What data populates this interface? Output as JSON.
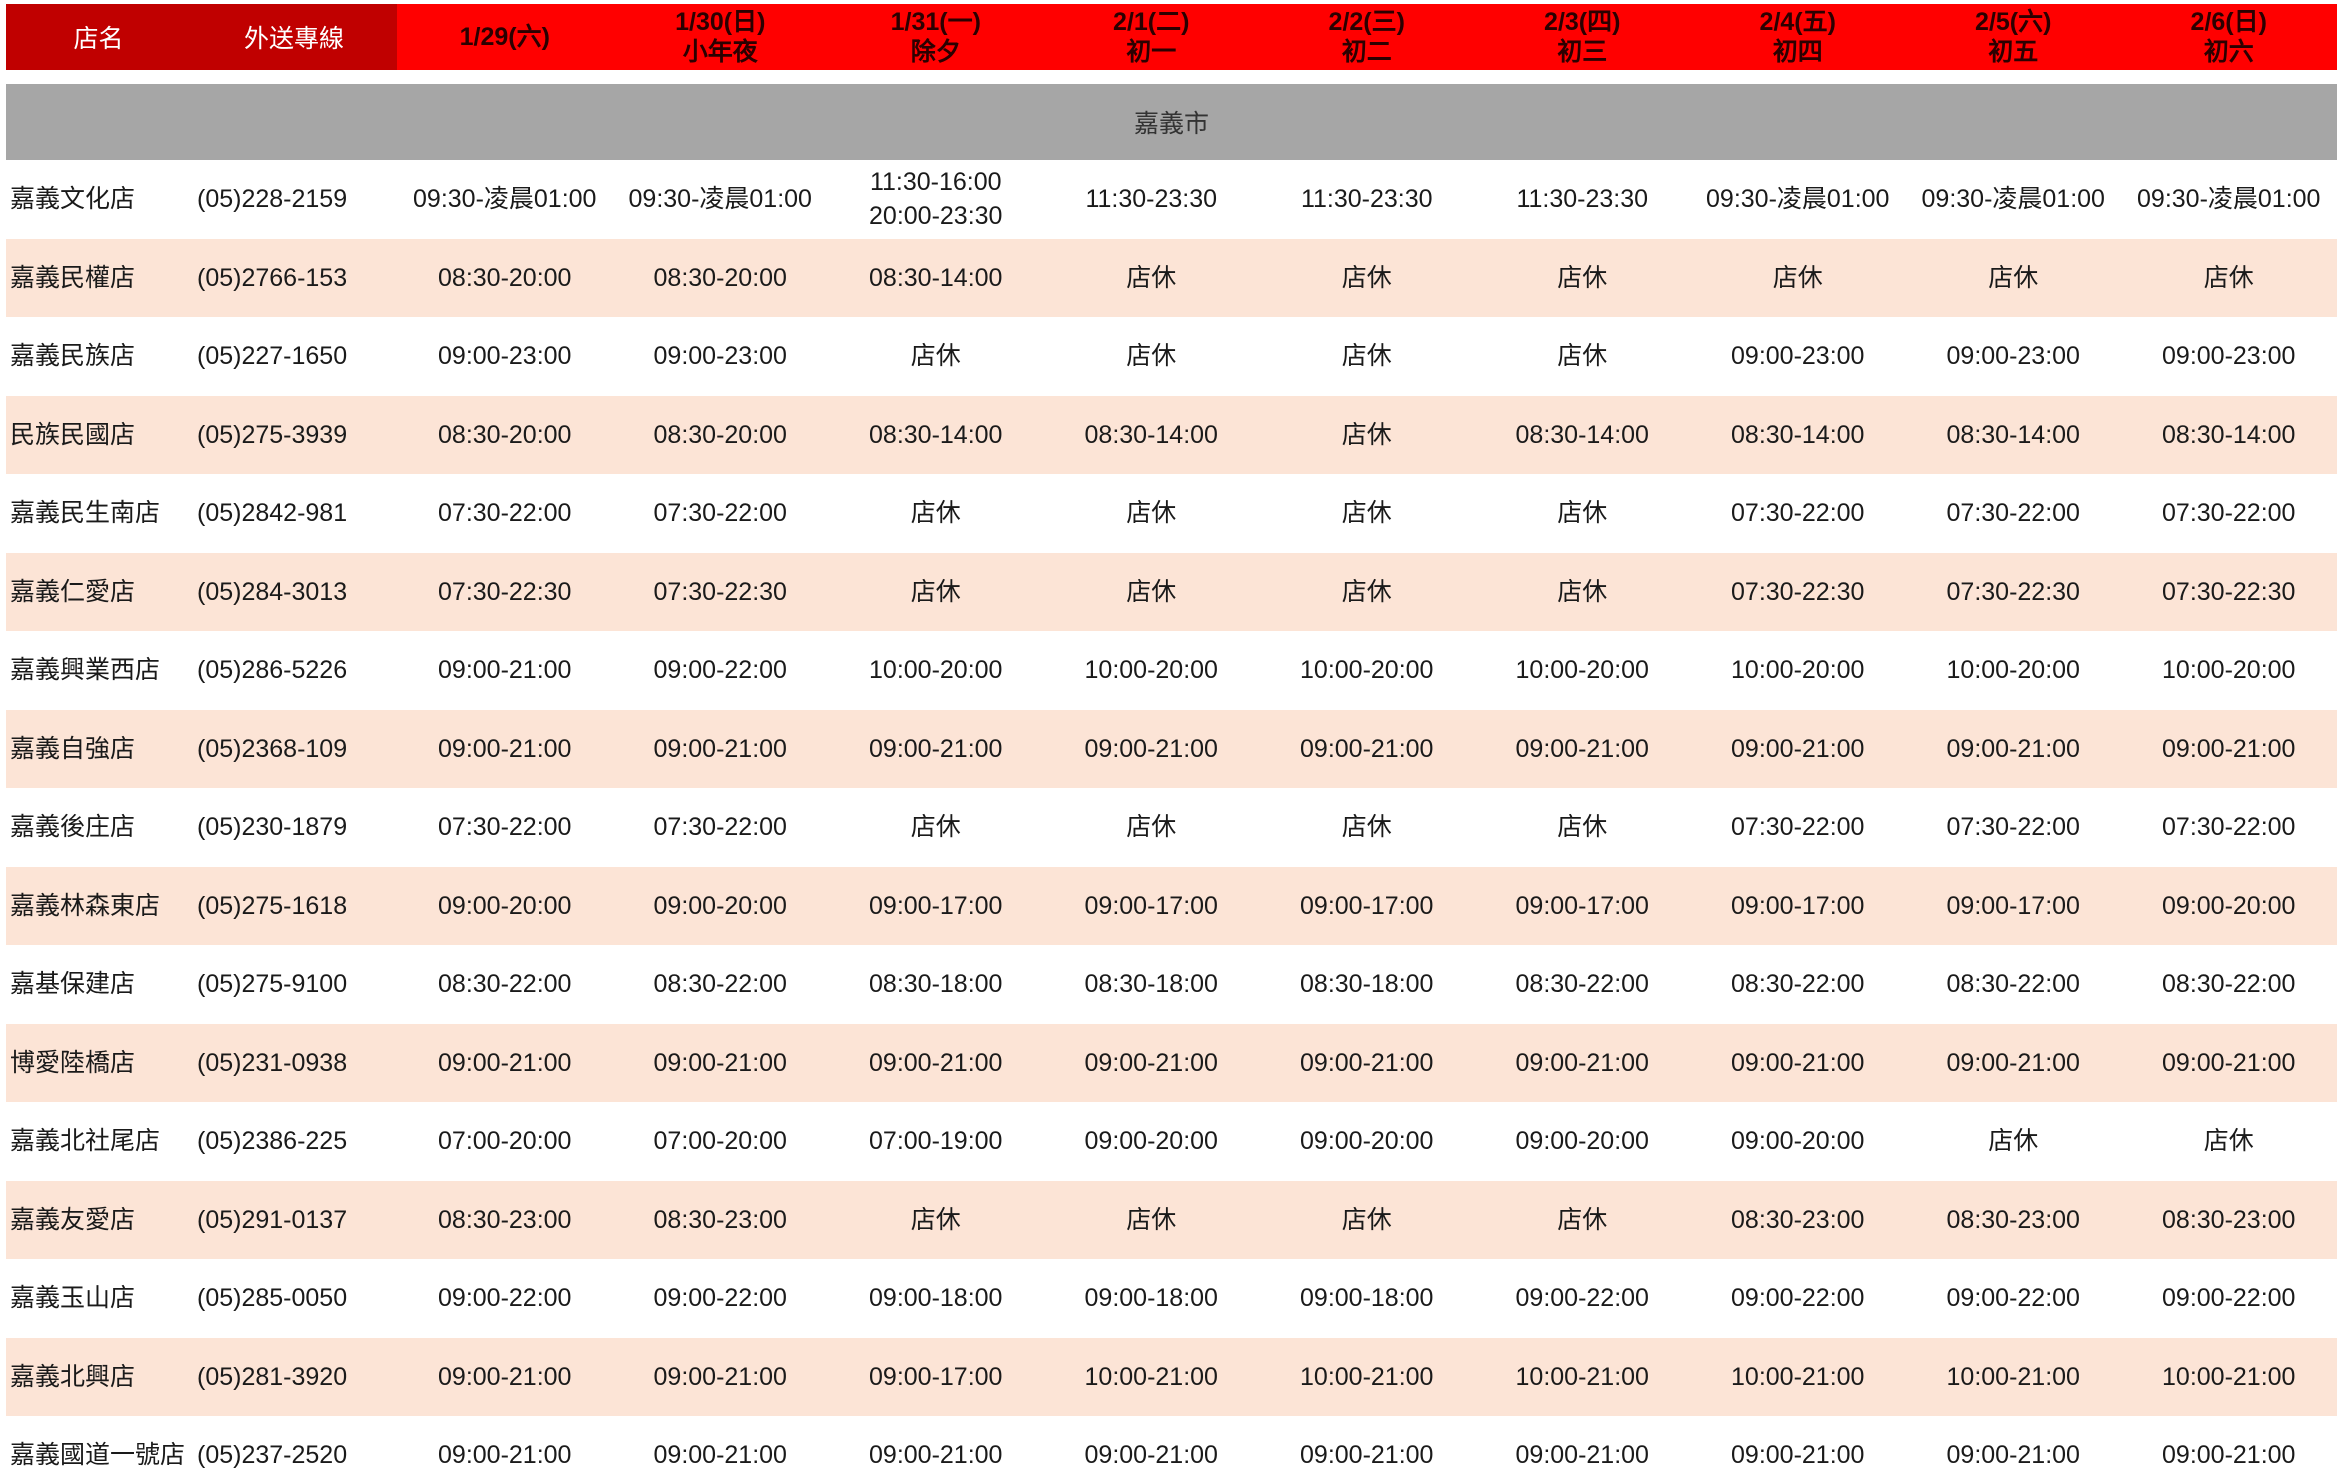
{
  "colors": {
    "header_dark_red": "#c00000",
    "header_red": "#ff0000",
    "section_gray": "#a6a6a6",
    "row_stripe": "#fce4d6"
  },
  "header": {
    "store_label": "店名",
    "phone_label": "外送專線",
    "days": [
      {
        "date": "1/29(六)"
      },
      {
        "date": "1/30(日)",
        "note": "小年夜"
      },
      {
        "date": "1/31(一)",
        "note": "除夕"
      },
      {
        "date": "2/1(二)",
        "note": "初一"
      },
      {
        "date": "2/2(三)",
        "note": "初二"
      },
      {
        "date": "2/3(四)",
        "note": "初三"
      },
      {
        "date": "2/4(五)",
        "note": "初四"
      },
      {
        "date": "2/5(六)",
        "note": "初五"
      },
      {
        "date": "2/6(日)",
        "note": "初六"
      }
    ]
  },
  "section": {
    "city": "嘉義市"
  },
  "stores": [
    {
      "name": "嘉義文化店",
      "phone": "(05)228-2159",
      "hours": [
        "09:30-凌晨01:00",
        "09:30-凌晨01:00",
        "11:30-16:00\n20:00-23:30",
        "11:30-23:30",
        "11:30-23:30",
        "11:30-23:30",
        "09:30-凌晨01:00",
        "09:30-凌晨01:00",
        "09:30-凌晨01:00"
      ]
    },
    {
      "name": "嘉義民權店",
      "phone": "(05)2766-153",
      "hours": [
        "08:30-20:00",
        "08:30-20:00",
        "08:30-14:00",
        "店休",
        "店休",
        "店休",
        "店休",
        "店休",
        "店休"
      ]
    },
    {
      "name": "嘉義民族店",
      "phone": "(05)227-1650",
      "hours": [
        "09:00-23:00",
        "09:00-23:00",
        "店休",
        "店休",
        "店休",
        "店休",
        "09:00-23:00",
        "09:00-23:00",
        "09:00-23:00"
      ]
    },
    {
      "name": "民族民國店",
      "phone": "(05)275-3939",
      "hours": [
        "08:30-20:00",
        "08:30-20:00",
        "08:30-14:00",
        "08:30-14:00",
        "店休",
        "08:30-14:00",
        "08:30-14:00",
        "08:30-14:00",
        "08:30-14:00"
      ]
    },
    {
      "name": "嘉義民生南店",
      "phone": "(05)2842-981",
      "hours": [
        "07:30-22:00",
        "07:30-22:00",
        "店休",
        "店休",
        "店休",
        "店休",
        "07:30-22:00",
        "07:30-22:00",
        "07:30-22:00"
      ]
    },
    {
      "name": "嘉義仁愛店",
      "phone": "(05)284-3013",
      "hours": [
        "07:30-22:30",
        "07:30-22:30",
        "店休",
        "店休",
        "店休",
        "店休",
        "07:30-22:30",
        "07:30-22:30",
        "07:30-22:30"
      ]
    },
    {
      "name": "嘉義興業西店",
      "phone": "(05)286-5226",
      "hours": [
        "09:00-21:00",
        "09:00-22:00",
        "10:00-20:00",
        "10:00-20:00",
        "10:00-20:00",
        "10:00-20:00",
        "10:00-20:00",
        "10:00-20:00",
        "10:00-20:00"
      ]
    },
    {
      "name": "嘉義自強店",
      "phone": "(05)2368-109",
      "hours": [
        "09:00-21:00",
        "09:00-21:00",
        "09:00-21:00",
        "09:00-21:00",
        "09:00-21:00",
        "09:00-21:00",
        "09:00-21:00",
        "09:00-21:00",
        "09:00-21:00"
      ]
    },
    {
      "name": "嘉義後庄店",
      "phone": "(05)230-1879",
      "hours": [
        "07:30-22:00",
        "07:30-22:00",
        "店休",
        "店休",
        "店休",
        "店休",
        "07:30-22:00",
        "07:30-22:00",
        "07:30-22:00"
      ]
    },
    {
      "name": "嘉義林森東店",
      "phone": "(05)275-1618",
      "hours": [
        "09:00-20:00",
        "09:00-20:00",
        "09:00-17:00",
        "09:00-17:00",
        "09:00-17:00",
        "09:00-17:00",
        "09:00-17:00",
        "09:00-17:00",
        "09:00-20:00"
      ]
    },
    {
      "name": "嘉基保建店",
      "phone": "(05)275-9100",
      "hours": [
        "08:30-22:00",
        "08:30-22:00",
        "08:30-18:00",
        "08:30-18:00",
        "08:30-18:00",
        "08:30-22:00",
        "08:30-22:00",
        "08:30-22:00",
        "08:30-22:00"
      ]
    },
    {
      "name": "博愛陸橋店",
      "phone": "(05)231-0938",
      "hours": [
        "09:00-21:00",
        "09:00-21:00",
        "09:00-21:00",
        "09:00-21:00",
        "09:00-21:00",
        "09:00-21:00",
        "09:00-21:00",
        "09:00-21:00",
        "09:00-21:00"
      ]
    },
    {
      "name": "嘉義北社尾店",
      "phone": "(05)2386-225",
      "hours": [
        "07:00-20:00",
        "07:00-20:00",
        "07:00-19:00",
        "09:00-20:00",
        "09:00-20:00",
        "09:00-20:00",
        "09:00-20:00",
        "店休",
        "店休"
      ]
    },
    {
      "name": "嘉義友愛店",
      "phone": "(05)291-0137",
      "hours": [
        "08:30-23:00",
        "08:30-23:00",
        "店休",
        "店休",
        "店休",
        "店休",
        "08:30-23:00",
        "08:30-23:00",
        "08:30-23:00"
      ]
    },
    {
      "name": "嘉義玉山店",
      "phone": "(05)285-0050",
      "hours": [
        "09:00-22:00",
        "09:00-22:00",
        "09:00-18:00",
        "09:00-18:00",
        "09:00-18:00",
        "09:00-22:00",
        "09:00-22:00",
        "09:00-22:00",
        "09:00-22:00"
      ]
    },
    {
      "name": "嘉義北興店",
      "phone": "(05)281-3920",
      "hours": [
        "09:00-21:00",
        "09:00-21:00",
        "09:00-17:00",
        "10:00-21:00",
        "10:00-21:00",
        "10:00-21:00",
        "10:00-21:00",
        "10:00-21:00",
        "10:00-21:00"
      ]
    },
    {
      "name": "嘉義國道一號店",
      "phone": "(05)237-2520",
      "hours": [
        "09:00-21:00",
        "09:00-21:00",
        "09:00-21:00",
        "09:00-21:00",
        "09:00-21:00",
        "09:00-21:00",
        "09:00-21:00",
        "09:00-21:00",
        "09:00-21:00"
      ]
    }
  ]
}
